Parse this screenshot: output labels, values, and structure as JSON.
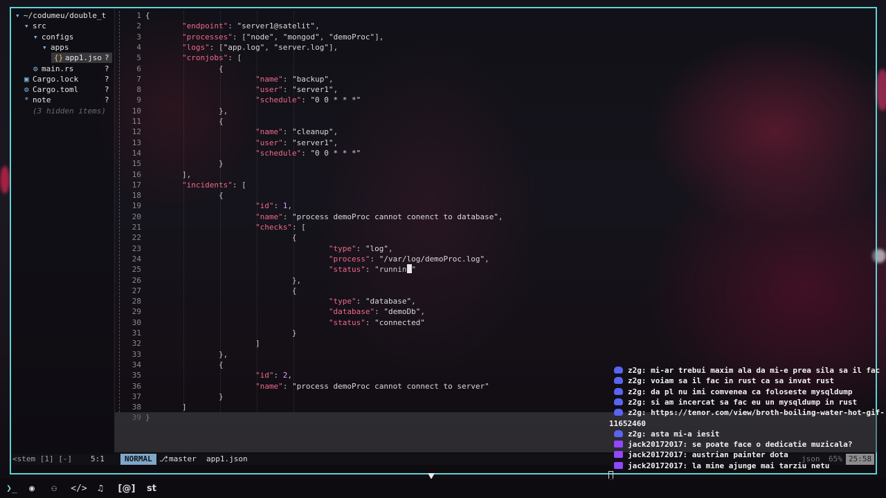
{
  "colors": {
    "frame_border": "#5fd3d6",
    "json_key": "#ec6a8a",
    "mode_badge_bg": "#7fa7c8",
    "discord": "#5865f2",
    "twitch": "#9146ff"
  },
  "file_tree": {
    "items": [
      {
        "icon": "folder-open-icon",
        "label": "~/codumeu/double_t",
        "indent": 0,
        "suffix": ""
      },
      {
        "icon": "folder-open-icon",
        "label": "src",
        "indent": 1,
        "suffix": ""
      },
      {
        "icon": "folder-open-icon",
        "label": "configs",
        "indent": 2,
        "suffix": ""
      },
      {
        "icon": "folder-open-icon",
        "label": "apps",
        "indent": 3,
        "suffix": ""
      },
      {
        "icon": "json-file-icon",
        "label": "app1.jso",
        "indent": 4,
        "suffix": "?"
      },
      {
        "icon": "rust-file-icon",
        "label": "main.rs",
        "indent": 2,
        "suffix": "?"
      },
      {
        "icon": "lock-icon",
        "label": "Cargo.lock",
        "indent": 1,
        "suffix": "?"
      },
      {
        "icon": "gear-icon",
        "label": "Cargo.toml",
        "indent": 1,
        "suffix": "?"
      },
      {
        "icon": "star-icon",
        "label": "note",
        "indent": 1,
        "suffix": "?"
      },
      {
        "icon": "",
        "label": "(3 hidden items)",
        "indent": 1,
        "suffix": ""
      }
    ]
  },
  "editor": {
    "lines": [
      "{",
      "        \"endpoint\": \"server1@satelit\",",
      "        \"processes\": [\"node\", \"mongod\", \"demoProc\"],",
      "        \"logs\": [\"app.log\", \"server.log\"],",
      "        \"cronjobs\": [",
      "                {",
      "                        \"name\": \"backup\",",
      "                        \"user\": \"server1\",",
      "                        \"schedule\": \"0 0 * * *\"",
      "                },",
      "                {",
      "                        \"name\": \"cleanup\",",
      "                        \"user\": \"server1\",",
      "                        \"schedule\": \"0 0 * * *\"",
      "                }",
      "        ],",
      "        \"incidents\": [",
      "                {",
      "                        \"id\": 1,",
      "                        \"name\": \"process demoProc cannot conenct to database\",",
      "                        \"checks\": [",
      "                                {",
      "                                        \"type\": \"log\",",
      "                                        \"process\": \"/var/log/demoProc.log\",",
      "                                        \"status\": \"running\"",
      "                                },",
      "                                {",
      "                                        \"type\": \"database\",",
      "                                        \"database\": \"demoDb\",",
      "                                        \"status\": \"connected\"",
      "                                }",
      "                        ]",
      "                },",
      "                {",
      "                        \"id\": 2,",
      "                        \"name\": \"process demoProc cannot connect to server\"",
      "                }",
      "        ]",
      "}"
    ],
    "cursor_line": 25
  },
  "statusline": {
    "left": "<stem [1] [-]",
    "position": "5:1",
    "mode": "NORMAL",
    "branch_icon": "git-branch-icon",
    "branch": "master",
    "file": "app1.json",
    "filetype": "json",
    "percent": "65%",
    "cursor_pos": "25:58"
  },
  "chat": {
    "messages": [
      {
        "platform": "discord",
        "text": "z2g: mi-ar trebui maxim ala da mi-e prea sila sa il fac"
      },
      {
        "platform": "discord",
        "text": "z2g: voiam sa il fac in rust ca sa invat rust"
      },
      {
        "platform": "discord",
        "text": "z2g: da pl nu imi comvenea ca foloseste mysqldump"
      },
      {
        "platform": "discord",
        "text": "z2g: si am incercat sa fac eu un mysqldump in rust"
      },
      {
        "platform": "discord",
        "text": "z2g: https://tenor.com/view/broth-boiling-water-hot-gif-"
      },
      {
        "platform": "",
        "text": "11652460"
      },
      {
        "platform": "discord",
        "text": "z2g: asta mi-a iesit"
      },
      {
        "platform": "twitch",
        "text": "jack20172017: se poate face o dedicatie muzicala?"
      },
      {
        "platform": "twitch",
        "text": "jack20172017: austrian painter dota"
      },
      {
        "platform": "twitch",
        "text": "jack20172017: la mine ajunge mai tarziu netu"
      }
    ]
  },
  "taskbar": {
    "items": [
      {
        "icon": "terminal-icon",
        "label": ""
      },
      {
        "icon": "globe-icon",
        "label": ""
      },
      {
        "icon": "chat-icon",
        "label": ""
      },
      {
        "icon": "code-icon",
        "label": ""
      },
      {
        "icon": "music-icon",
        "label": ""
      },
      {
        "icon": "at-icon",
        "label": "[@]"
      },
      {
        "icon": "",
        "label": "st"
      }
    ]
  }
}
